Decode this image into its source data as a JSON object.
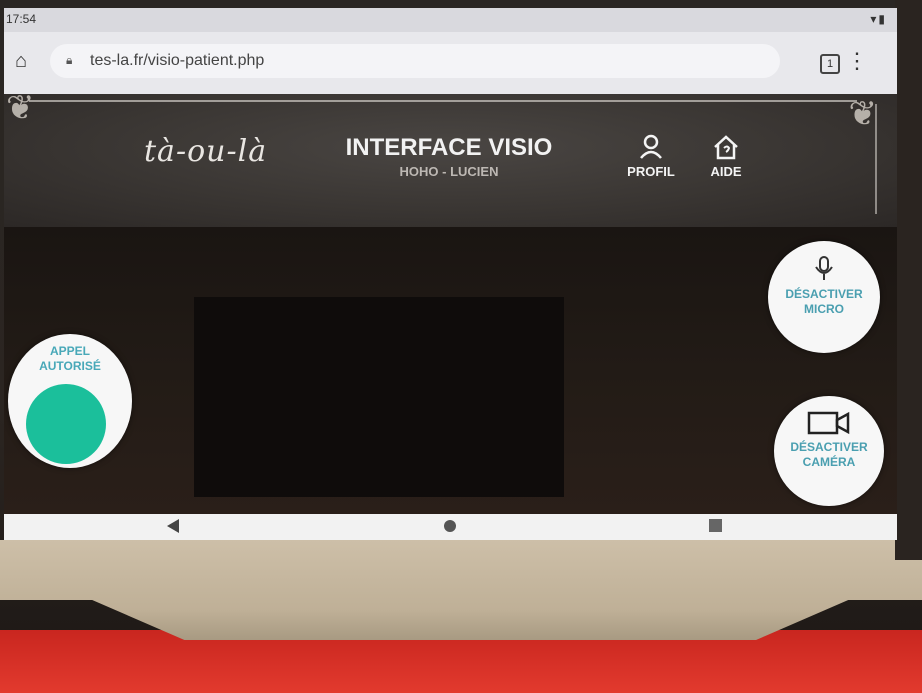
{
  "statusbar": {
    "time": "17:54"
  },
  "browser": {
    "url": "tes-la.fr/visio-patient.php",
    "tab_count": "1"
  },
  "header": {
    "logo": "tà-ou-là",
    "title": "INTERFACE VISIO",
    "subtitle": "HOHO - LUCIEN",
    "nav": [
      {
        "label": "PROFIL",
        "icon": "user-icon"
      },
      {
        "label": "AIDE",
        "icon": "help-house-icon"
      }
    ]
  },
  "controls": {
    "appel": {
      "line1": "APPEL",
      "line2": "AUTORISÉ",
      "color": "#1bbf9b"
    },
    "micro": {
      "line1": "DÉSACTIVER",
      "line2": "MICRO",
      "icon": "microphone-icon"
    },
    "camera": {
      "line1": "DÉSACTIVER",
      "line2": "CAMÉRA",
      "icon": "video-camera-icon"
    }
  },
  "colors": {
    "accent_text": "#4a9fb0",
    "status_green": "#1bbf9b"
  }
}
